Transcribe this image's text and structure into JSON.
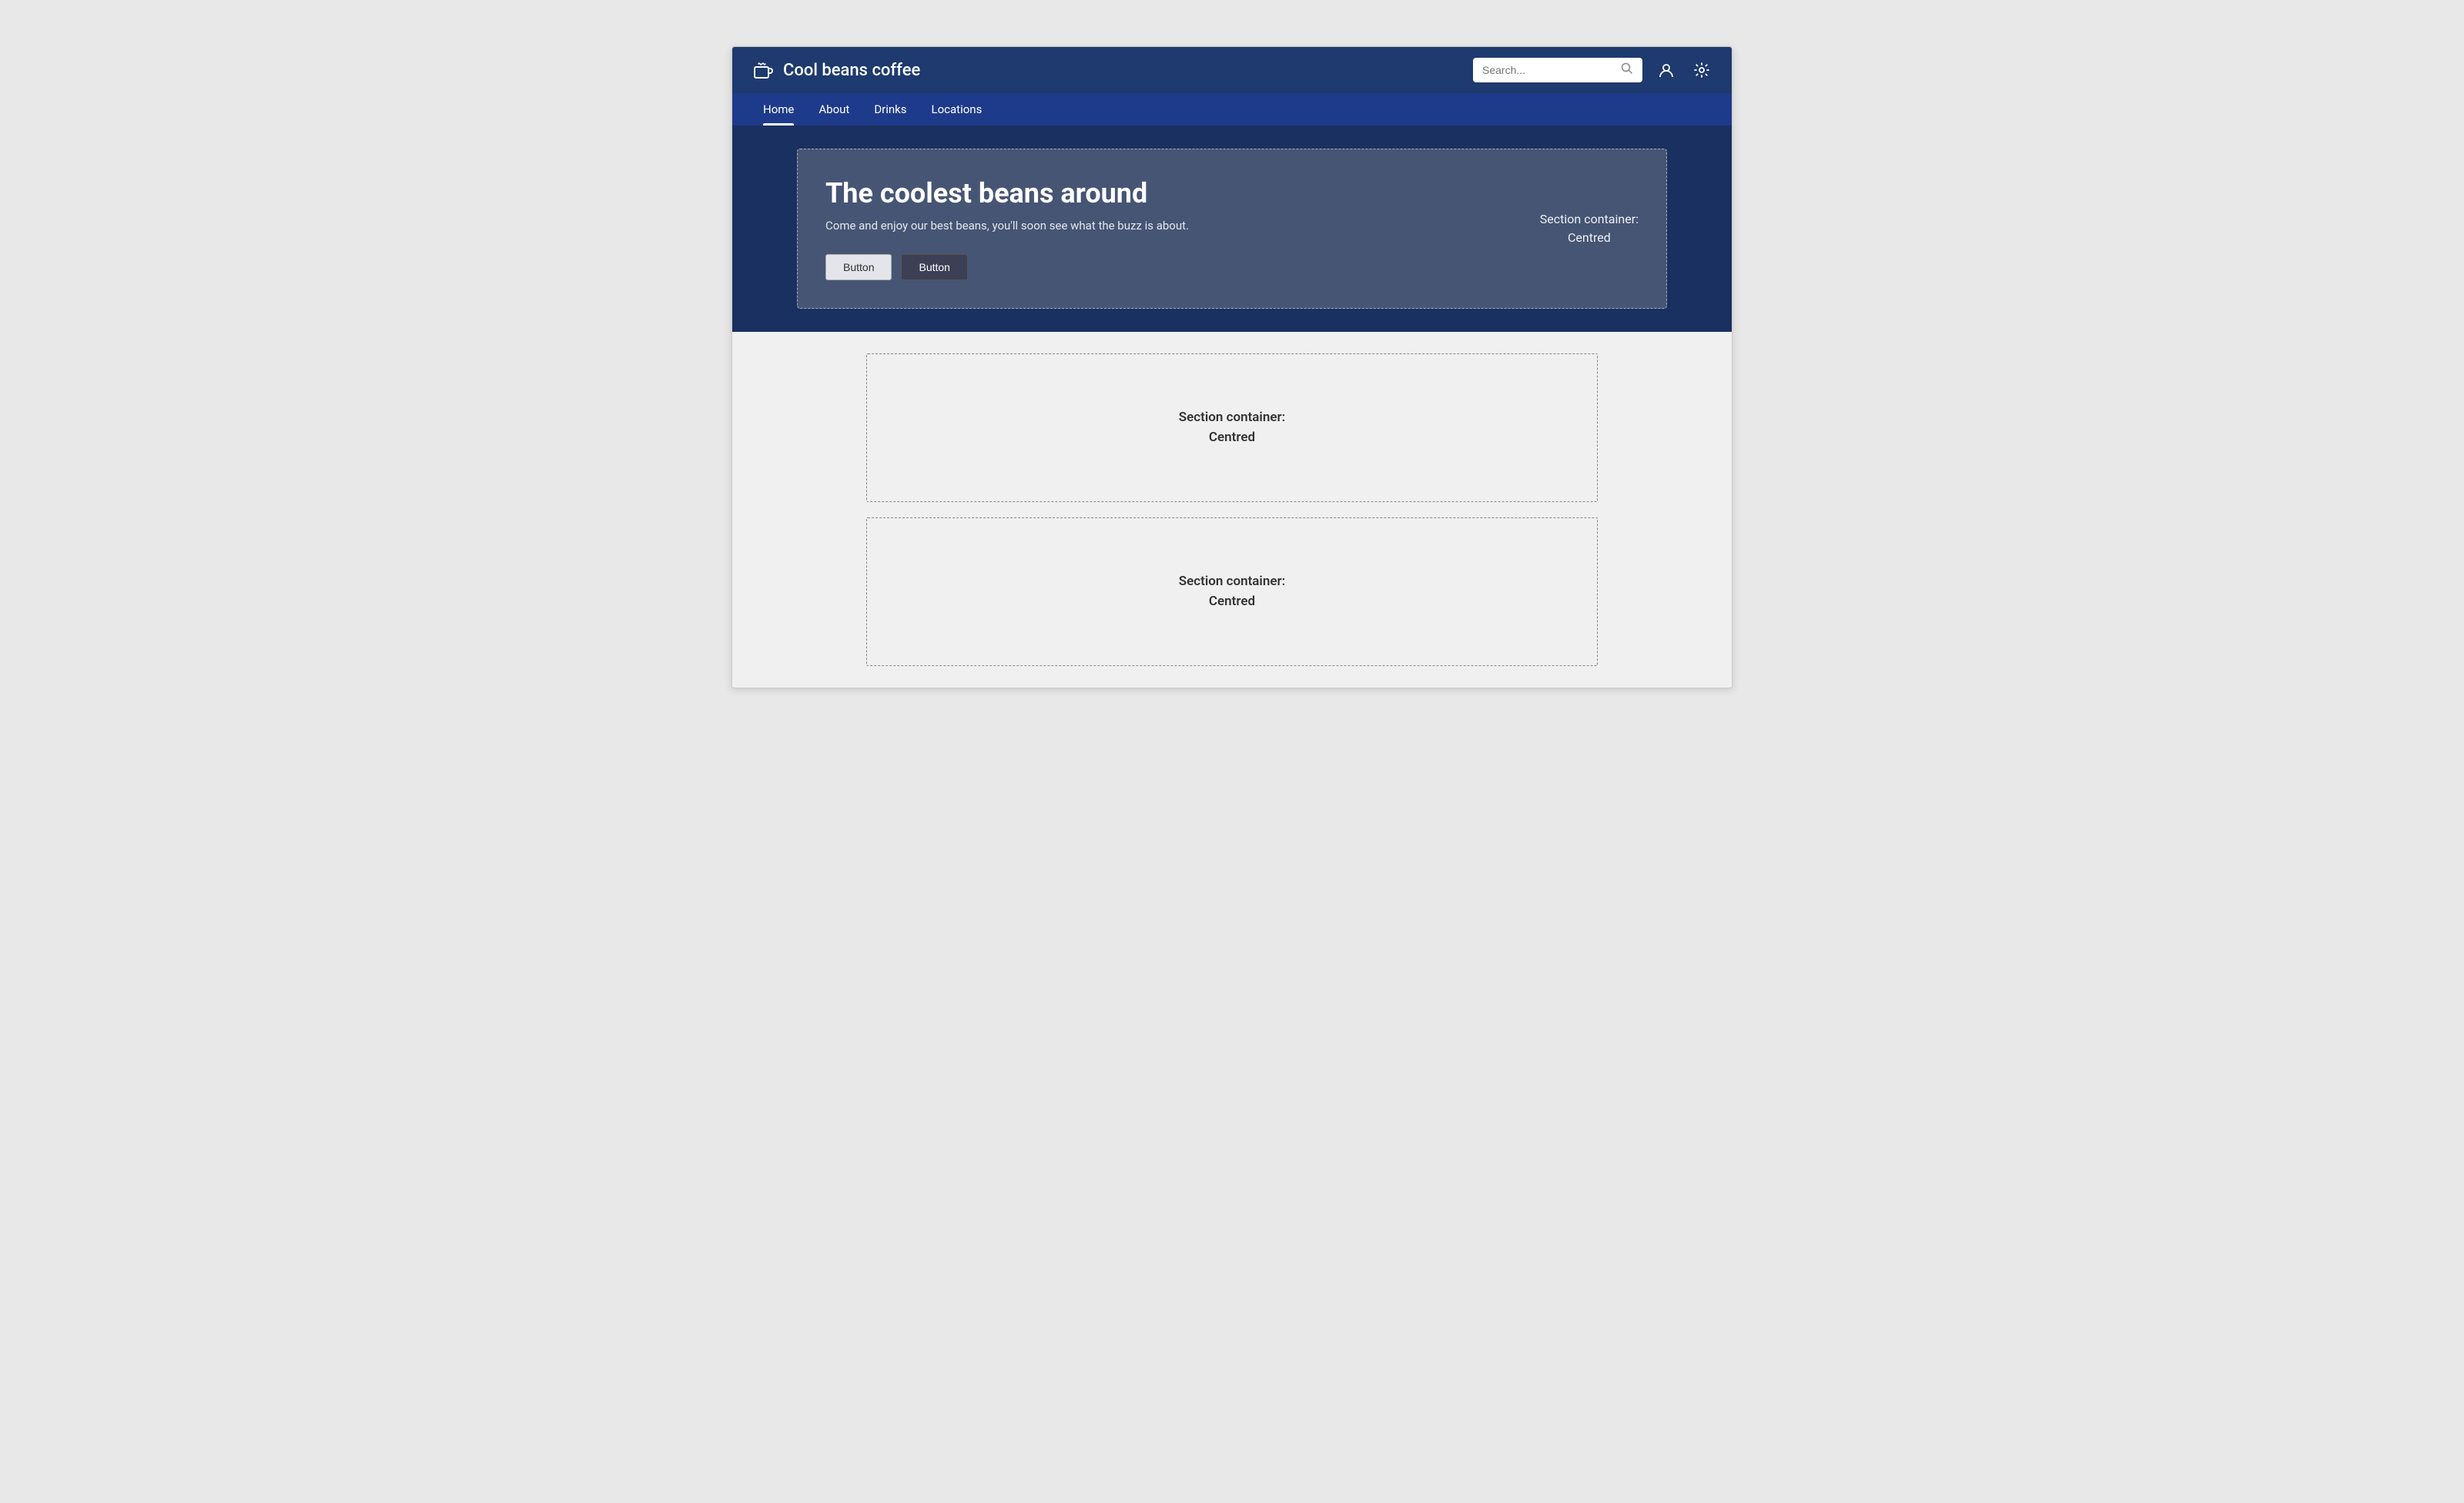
{
  "brand": {
    "name": "Cool beans coffee"
  },
  "search": {
    "placeholder": "Search..."
  },
  "nav": {
    "items": [
      {
        "label": "Home",
        "active": true
      },
      {
        "label": "About",
        "active": false
      },
      {
        "label": "Drinks",
        "active": false
      },
      {
        "label": "Locations",
        "active": false
      }
    ]
  },
  "hero": {
    "title": "The coolest beans around",
    "subtitle": "Come and enjoy our best beans, you'll soon see what the buzz is about.",
    "button1": "Button",
    "button2": "Button",
    "section_label_line1": "Section container:",
    "section_label_line2": "Centred"
  },
  "sections": [
    {
      "label_line1": "Section container:",
      "label_line2": "Centred"
    },
    {
      "label_line1": "Section container:",
      "label_line2": "Centred"
    }
  ]
}
